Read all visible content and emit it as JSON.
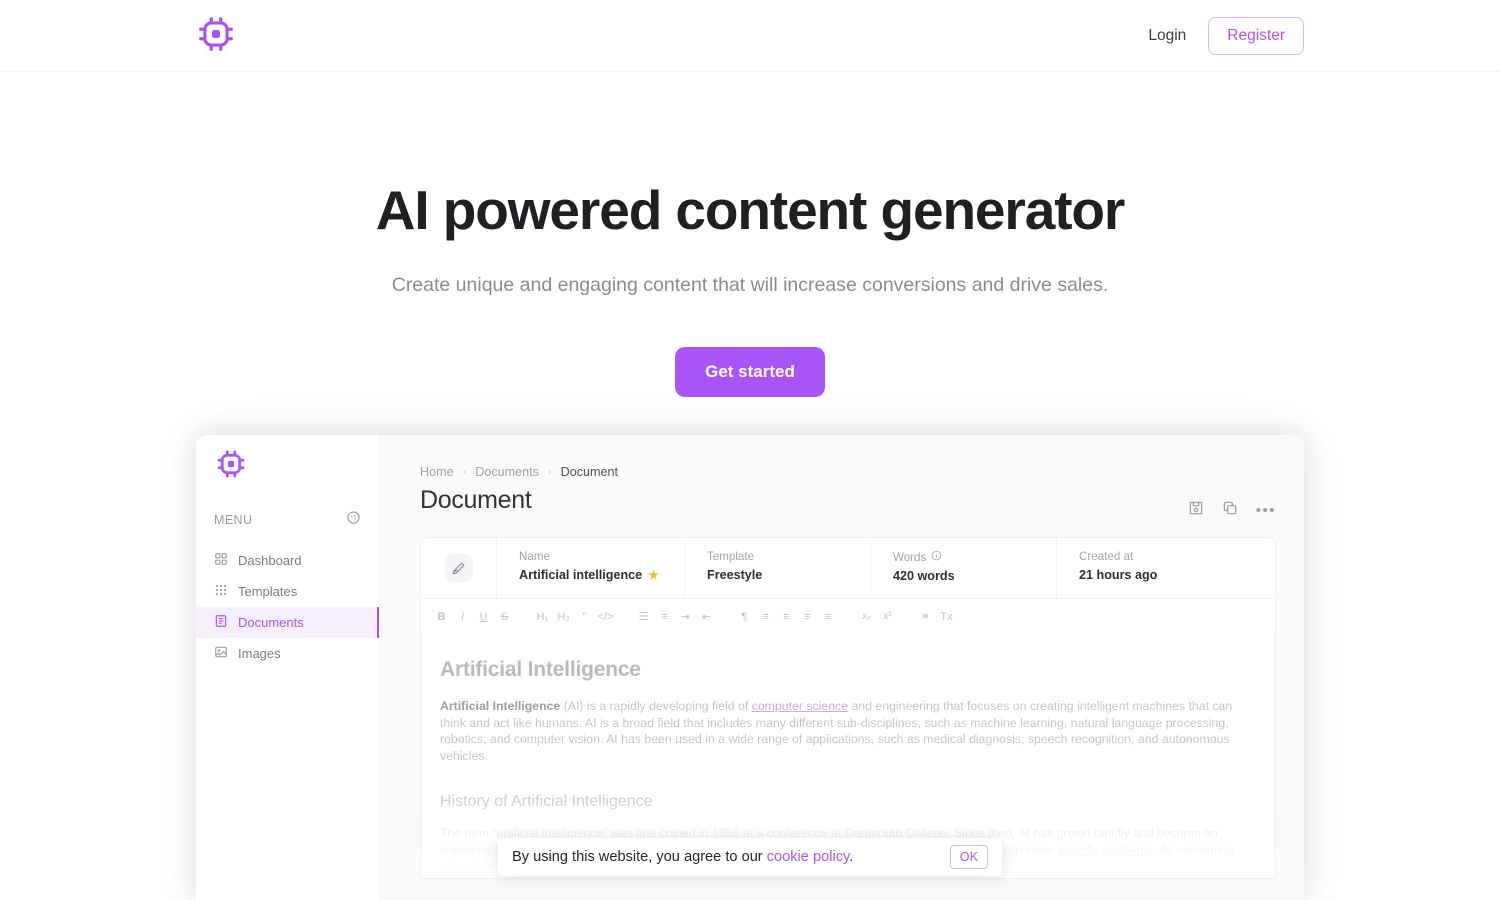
{
  "navbar": {
    "logo_icon": "cpu-chip-icon",
    "login_label": "Login",
    "register_label": "Register"
  },
  "hero": {
    "title": "AI powered content generator",
    "subtitle": "Create unique and engaging content that will increase conversions and drive sales.",
    "cta_label": "Get started"
  },
  "preview": {
    "sidebar": {
      "logo_icon": "cpu-chip-icon",
      "menu_label": "MENU",
      "theme_icon": "palette-icon",
      "items": [
        {
          "label": "Dashboard",
          "icon": "grid-2x2-icon",
          "active": false
        },
        {
          "label": "Templates",
          "icon": "grid-3x3-dots-icon",
          "active": false
        },
        {
          "label": "Documents",
          "icon": "document-icon",
          "active": true
        },
        {
          "label": "Images",
          "icon": "image-icon",
          "active": false
        }
      ]
    },
    "breadcrumb": {
      "items": [
        "Home",
        "Documents",
        "Document"
      ],
      "separator": "›"
    },
    "page_title": "Document",
    "actions": [
      {
        "name": "save-icon"
      },
      {
        "name": "copy-icon"
      },
      {
        "name": "more-options-icon",
        "label": "•••"
      }
    ],
    "meta": {
      "edit_icon": "edit-pencil-icon",
      "fields": [
        {
          "label": "Name",
          "value": "Artificial intelligence",
          "starred": true,
          "star": "★"
        },
        {
          "label": "Template",
          "value": "Freestyle"
        },
        {
          "label": "Words",
          "value": "420 words",
          "info_icon": "info-icon"
        },
        {
          "label": "Created at",
          "value": "21 hours ago"
        }
      ]
    },
    "toolbar": {
      "groups": [
        [
          "B",
          "I",
          "U",
          "S"
        ],
        [
          "H₁",
          "H₂",
          "”",
          "</>"
        ],
        [
          "☰",
          "≡",
          "⇥",
          "⇤"
        ],
        [
          "¶",
          "≡",
          "≡",
          "≡",
          "≡"
        ],
        [
          "x₂",
          "x²"
        ],
        [
          "⚭",
          "Tx"
        ]
      ]
    },
    "document": {
      "heading": "Artificial Intelligence",
      "paragraph_lead": "Artificial Intelligence",
      "paragraph_part1": " (AI) is a rapidly developing field of ",
      "paragraph_link": "computer science",
      "paragraph_part2": " and engineering that focuses on creating intelligent machines that can think and act like humans. AI is a broad field that includes many different sub-disciplines, such as machine learning, natural language processing, robotics, and computer vision. AI has been used in a wide range of applications, such as medical diagnosis, speech recognition, and autonomous vehicles.",
      "subheading": "History of Artificial Intelligence",
      "paragraph2_part1": "The term “artificial intelligence” was first coined in 1956 at a conference at Dartmouth College. Since then, AI has grown rapidly and become an important field of research. In the early days of AI, researchers focused on developing algorithms that could solve ",
      "paragraph2_link": "specific problems",
      "paragraph2_part2": ". As computing power increased, more complex tasks, such as natural language processing,"
    }
  },
  "cookie_banner": {
    "text_before": "By using this website, you agree to our ",
    "link_label": "cookie policy",
    "text_after": ".",
    "ok_label": "OK"
  },
  "colors": {
    "brand_purple": "#a855f7",
    "brand_purple_light": "#d8b4fe",
    "active_bg": "#f6effd",
    "star_gold": "#fbbf24",
    "text_dark": "#1f2024",
    "text_muted": "#8b8b93"
  }
}
